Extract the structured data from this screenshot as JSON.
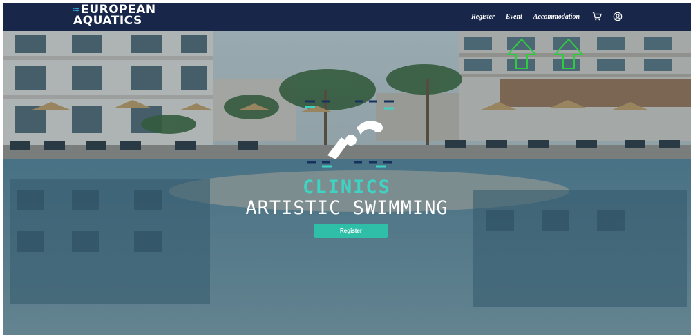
{
  "brand": {
    "logo_line1": "EUROPEAN",
    "logo_line2": "AQUATICS"
  },
  "nav": {
    "items": [
      {
        "label": "Register"
      },
      {
        "label": "Event"
      },
      {
        "label": "Accommodation"
      }
    ],
    "icons": [
      "cart-icon",
      "user-icon"
    ]
  },
  "hero": {
    "title": "CLINICS",
    "subtitle": "ARTISTIC SWIMMING",
    "button_label": "Register"
  },
  "colors": {
    "navbar": "#18264a",
    "accent_teal": "#3fd3c4",
    "button": "#2fbfa9",
    "annotation_arrows": "#2ecc40"
  }
}
